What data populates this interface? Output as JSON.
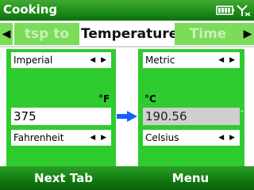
{
  "window": {
    "title": "Cooking"
  },
  "tabs": {
    "prev_label": "tsp to ml",
    "active_label": "Temperature",
    "next_label": "Time",
    "left_arrow": "◀",
    "right_arrow": "▶"
  },
  "from": {
    "system": "Imperial",
    "unit_symbol": "°F",
    "value": "375",
    "unit": "Fahrenheit"
  },
  "to": {
    "system": "Metric",
    "unit_symbol": "°C",
    "value": "190.56",
    "unit": "Celsius",
    "suffix_mark": "°"
  },
  "selector_arrows": "◀ ▶",
  "softkeys": {
    "left": "Next Tab",
    "right": "Menu"
  },
  "colors": {
    "panel_green": "#2ecc2e",
    "bar_green": "#1d8f1a",
    "tab_green": "#7bdc5a",
    "arrow_blue": "#1560ff"
  }
}
